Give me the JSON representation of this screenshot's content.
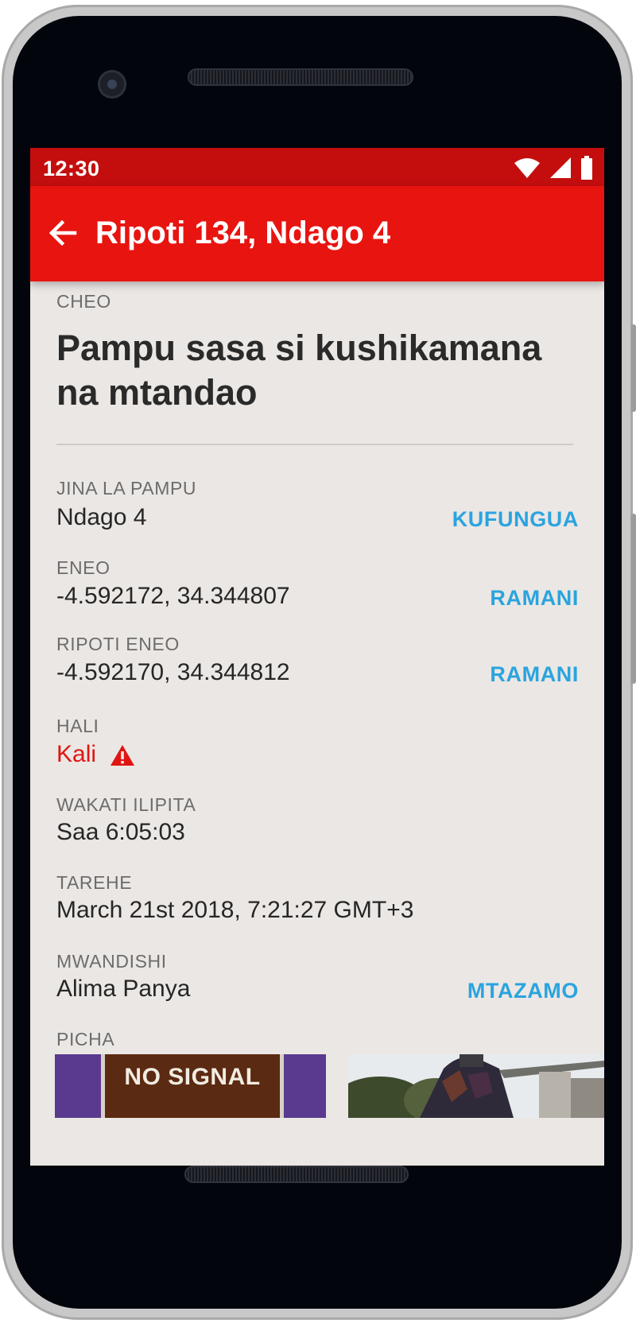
{
  "status_bar": {
    "time": "12:30"
  },
  "app_bar": {
    "title": "Ripoti 134, Ndago 4"
  },
  "report": {
    "title_label": "CHEO",
    "title": "Pampu sasa si kushikamana na mtandao",
    "pump_name": {
      "label": "JINA LA PAMPU",
      "value": "Ndago 4",
      "action": "KUFUNGUA"
    },
    "location": {
      "label": "ENEO",
      "value": "-4.592172, 34.344807",
      "action": "RAMANI"
    },
    "report_location": {
      "label": "RIPOTI ENEO",
      "value": "-4.592170, 34.344812",
      "action": "RAMANI"
    },
    "status": {
      "label": "HALI",
      "value": "Kali"
    },
    "time_elapsed": {
      "label": "WAKATI ILIPITA",
      "value": "Saa 6:05:03"
    },
    "date": {
      "label": "TAREHE",
      "value": "March 21st 2018, 7:21:27 GMT+3"
    },
    "author": {
      "label": "MWANDISHI",
      "value": "Alima Panya",
      "action": "MTAZAMO"
    },
    "photos_label": "PICHA",
    "photo_1_text": "NO SIGNAL"
  },
  "colors": {
    "status_bar": "#c40e0e",
    "app_bar": "#e81410",
    "action": "#2aa4df",
    "severity": "#e01512",
    "background": "#ebe7e4"
  },
  "icons": [
    "back-arrow-icon",
    "wifi-icon",
    "cell-signal-icon",
    "battery-icon",
    "warning-icon"
  ]
}
